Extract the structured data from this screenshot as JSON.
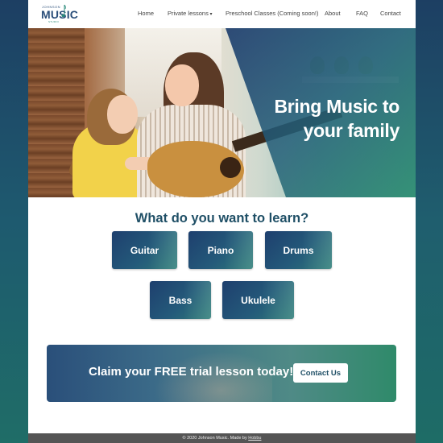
{
  "brand": {
    "logo_top": "JOHNSON",
    "logo_main": "MUSIC",
    "logo_sub": "STUDIO"
  },
  "nav": {
    "home": "Home",
    "private": "Private lessons",
    "preschool": "Preschool Classes (Coming soon!)",
    "about": "About",
    "faq": "FAQ",
    "contact": "Contact"
  },
  "hero": {
    "line1": "Bring Music to",
    "line2": "your family"
  },
  "learn": {
    "title": "What do you want to learn?",
    "instruments": [
      "Guitar",
      "Piano",
      "Drums",
      "Bass",
      "Ukulele"
    ]
  },
  "cta": {
    "text": "Claim your FREE trial lesson today!",
    "button": "Contact Us"
  },
  "footer": {
    "text": "© 2020 Johnson Music. Made by ",
    "link": "Hobbu"
  },
  "colors": {
    "brand_dark": "#1f4f66",
    "accent_teal": "#2f8a6a"
  }
}
